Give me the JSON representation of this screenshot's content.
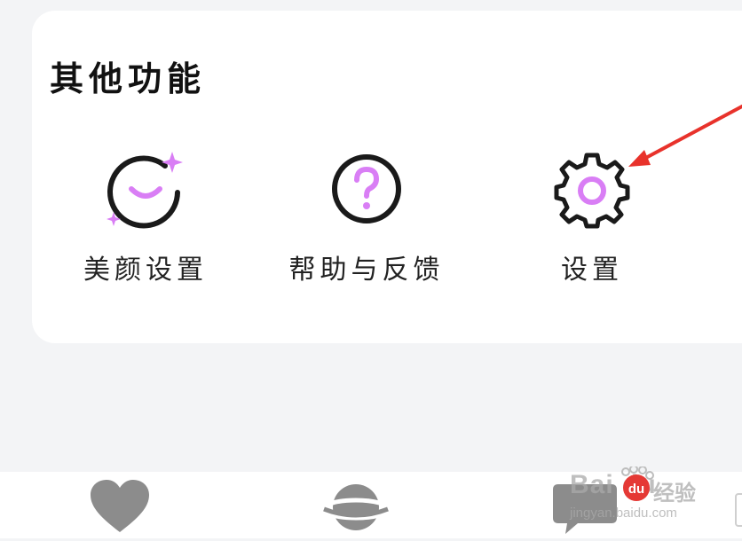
{
  "section": {
    "title": "其他功能"
  },
  "features": [
    {
      "id": "beauty",
      "label": "美颜设置",
      "icon": "beauty-face-sparkle-icon"
    },
    {
      "id": "help",
      "label": "帮助与反馈",
      "icon": "question-mark-icon"
    },
    {
      "id": "settings",
      "label": "设置",
      "icon": "gear-icon"
    }
  ],
  "tabbar": {
    "tabs": [
      {
        "id": "likes",
        "icon": "heart-icon"
      },
      {
        "id": "planet",
        "icon": "planet-icon"
      },
      {
        "id": "messages",
        "icon": "chat-bubble-icon"
      }
    ]
  },
  "watermark": {
    "brand": "Bai du",
    "cn": "经验",
    "url": "jingyan.baidu.com"
  },
  "colors": {
    "accent": "#d97ef5",
    "icon_stroke": "#1a1a1a",
    "annotation_arrow": "#e8322b",
    "tab_icon": "#8c8c8c",
    "background": "#f3f4f6",
    "card": "#ffffff"
  }
}
